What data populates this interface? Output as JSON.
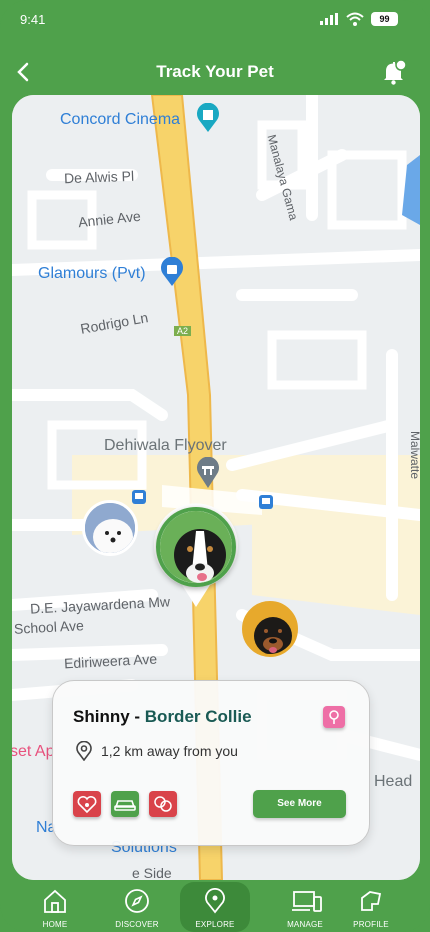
{
  "status": {
    "time": "9:41",
    "battery": "99"
  },
  "header": {
    "title": "Track Your Pet",
    "back_icon": "chevron-left-icon",
    "bell_icon": "bell-icon"
  },
  "map": {
    "labels": {
      "concord": "Concord Cinema",
      "de_alwis": "De Alwis Pl",
      "annie": "Annie Ave",
      "glamours": "Glamours (Pvt)",
      "rodrigo": "Rodrigo Ln",
      "a2": "A2",
      "dehiwala": "Dehiwala Flyover",
      "jayawardena": "D.E. Jayawardena Mw",
      "school": "School Ave",
      "ediriweera": "Ediriweera Ave",
      "gama": "Manalaya Gama",
      "malwatte": "Malwatte",
      "head": "Head",
      "solutions": "Solutions",
      "side": "e Side",
      "set": "set Ap",
      "na": "Na"
    }
  },
  "card": {
    "pet_name": "Shinny",
    "separator": " - ",
    "breed": "Border Collie",
    "distance": "1,2 km away from you",
    "see_more": "See More",
    "badges": [
      "heart-paw-icon",
      "car-icon",
      "pets-icon"
    ]
  },
  "nav": {
    "items": [
      {
        "label": "HOME",
        "icon": "home-icon"
      },
      {
        "label": "DISCOVER",
        "icon": "compass-icon"
      },
      {
        "label": "EXPLORE",
        "icon": "location-pin-icon"
      },
      {
        "label": "MANAGE",
        "icon": "devices-icon"
      },
      {
        "label": "PROFILE",
        "icon": "profile-icon"
      }
    ]
  },
  "colors": {
    "brand": "#4fa14b",
    "breed": "#1a5a54",
    "pink": "#ee6fa6",
    "red_badge": "#d9434a"
  }
}
